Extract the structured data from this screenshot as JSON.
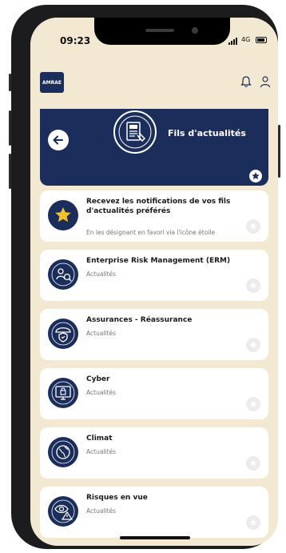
{
  "status_bar": {
    "time": "09:23",
    "network": "4G"
  },
  "app": {
    "logo_text": "AMRAE"
  },
  "banner": {
    "title": "Fils d'actualités"
  },
  "cards": [
    {
      "title": "Recevez les notifications de vos fils d'actualités préférés",
      "subtitle": "En les désignant en favori via l'icône étoile",
      "icon": "star-icon"
    },
    {
      "title": "Enterprise Risk Management (ERM)",
      "subtitle": "Actualités",
      "icon": "erm-icon"
    },
    {
      "title": "Assurances - Réassurance",
      "subtitle": "Actualités",
      "icon": "umbrella-shield-icon"
    },
    {
      "title": "Cyber",
      "subtitle": "Actualités",
      "icon": "monitor-lock-icon"
    },
    {
      "title": "Climat",
      "subtitle": "Actualités",
      "icon": "globe-icon"
    },
    {
      "title": "Risques en vue",
      "subtitle": "Actualités",
      "icon": "eye-warning-icon"
    }
  ],
  "colors": {
    "navy": "#1b2d5b",
    "background": "#f3e9d2",
    "star_yellow": "#f2c12e"
  }
}
